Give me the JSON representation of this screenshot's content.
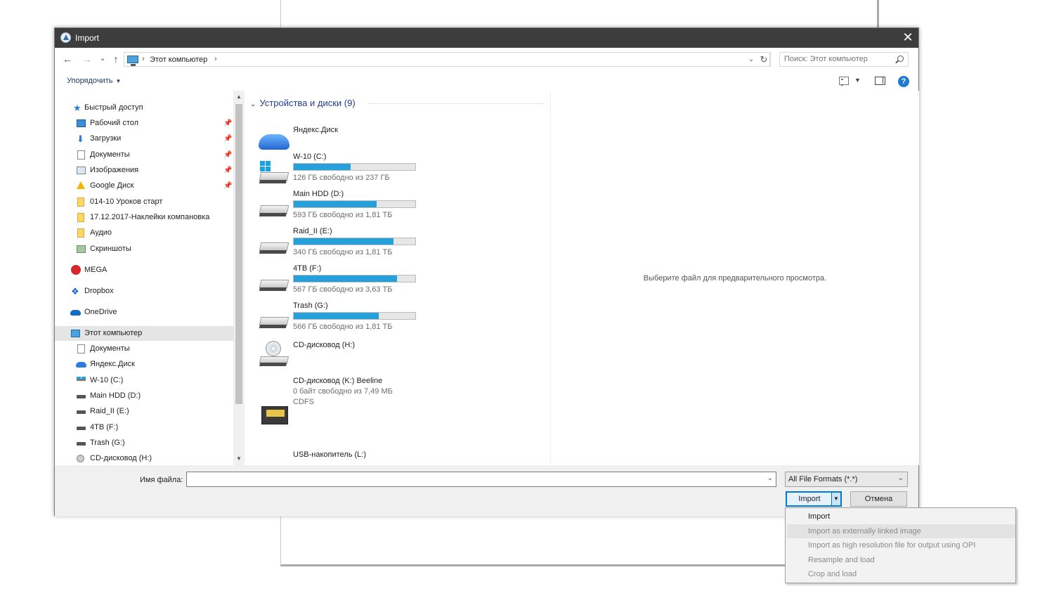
{
  "dialog": {
    "title": "Import",
    "close_glyph": "✕"
  },
  "nav": {
    "back": "←",
    "forward": "→",
    "recent": "⌄",
    "up": "↑"
  },
  "address": {
    "crumb_sep": "›",
    "location": "Этот компьютер",
    "end_sep": "›",
    "dropdown": "⌄",
    "refresh": "↻"
  },
  "search": {
    "placeholder": "Поиск: Этот компьютер"
  },
  "toolbar": {
    "organize": "Упорядочить",
    "organize_caret": "▼",
    "view_caret": "▼",
    "help": "?"
  },
  "sidebar": {
    "quick_access": "Быстрый доступ",
    "items": [
      {
        "label": "Рабочий стол",
        "icon": "desktop-icon",
        "pinned": true
      },
      {
        "label": "Загрузки",
        "icon": "download-icon",
        "pinned": true
      },
      {
        "label": "Документы",
        "icon": "document-icon",
        "pinned": true
      },
      {
        "label": "Изображения",
        "icon": "pictures-icon",
        "pinned": true
      },
      {
        "label": "Google Диск",
        "icon": "google-drive-icon",
        "pinned": true
      },
      {
        "label": "014-10 Уроков старт",
        "icon": "folder-icon",
        "pinned": false
      },
      {
        "label": "17.12.2017-Наклейки компановка",
        "icon": "folder-icon",
        "pinned": false
      },
      {
        "label": "Аудио",
        "icon": "folder-icon",
        "pinned": false
      },
      {
        "label": "Скриншоты",
        "icon": "screenshots-icon",
        "pinned": false
      }
    ],
    "pin_glyph": "📌",
    "mega": "MEGA",
    "dropbox": "Dropbox",
    "onedrive": "OneDrive",
    "this_pc": "Этот компьютер",
    "pc_items": [
      {
        "label": "Документы",
        "icon": "document-icon"
      },
      {
        "label": "Яндекс.Диск",
        "icon": "yandex-disk-icon"
      },
      {
        "label": "W-10 (C:)",
        "icon": "windows-drive-icon"
      },
      {
        "label": "Main HDD (D:)",
        "icon": "hdd-icon"
      },
      {
        "label": "Raid_II (E:)",
        "icon": "hdd-icon"
      },
      {
        "label": "4TB (F:)",
        "icon": "hdd-icon"
      },
      {
        "label": "Trash (G:)",
        "icon": "hdd-icon"
      },
      {
        "label": "CD-дисковод (H:)",
        "icon": "cd-icon"
      }
    ],
    "scroll_up": "▲",
    "scroll_down": "▼"
  },
  "content": {
    "group_chevron": "⌄",
    "group_title": "Устройства и диски (9)",
    "drives": [
      {
        "name": "Яндекс.Диск",
        "kind": "cloud"
      },
      {
        "name": "W-10 (C:)",
        "kind": "system",
        "free": "126 ГБ свободно из 237 ГБ",
        "used_fraction": 0.47
      },
      {
        "name": "Main HDD (D:)",
        "kind": "hdd",
        "free": "593 ГБ свободно из 1,81 ТБ",
        "used_fraction": 0.68
      },
      {
        "name": "Raid_II (E:)",
        "kind": "hdd",
        "free": "340 ГБ свободно из 1,81 ТБ",
        "used_fraction": 0.82
      },
      {
        "name": "4TB (F:)",
        "kind": "hdd",
        "free": "567 ГБ свободно из 3,63 ТБ",
        "used_fraction": 0.85
      },
      {
        "name": "Trash (G:)",
        "kind": "hdd",
        "free": "566 ГБ свободно из 1,81 ТБ",
        "used_fraction": 0.7
      },
      {
        "name": "CD-дисковод (H:)",
        "kind": "cd"
      },
      {
        "name": "CD-дисковод (K:) Beeline",
        "kind": "beeline",
        "free": "0 байт свободно из 7,49 МБ",
        "fs": "CDFS"
      },
      {
        "name": "USB-накопитель (L:)",
        "kind": "usb"
      }
    ]
  },
  "preview": {
    "message": "Выберите файл для предварительного просмотра."
  },
  "footer": {
    "filename_label": "Имя файла:",
    "filename_value": "",
    "filename_dropdown": "⌄",
    "filter_value": "All File Formats (*.*)",
    "filter_dropdown": "⌄",
    "import_label": "Import",
    "import_split": "▼",
    "cancel_label": "Отмена"
  },
  "menu": {
    "items": [
      {
        "label": "Import",
        "enabled": true
      },
      {
        "label": "Import as externally linked image",
        "enabled": false
      },
      {
        "label": "Import as high resolution file for output using OPI",
        "enabled": false
      },
      {
        "label": "Resample and load",
        "enabled": false
      },
      {
        "label": "Crop and load",
        "enabled": false
      }
    ]
  }
}
